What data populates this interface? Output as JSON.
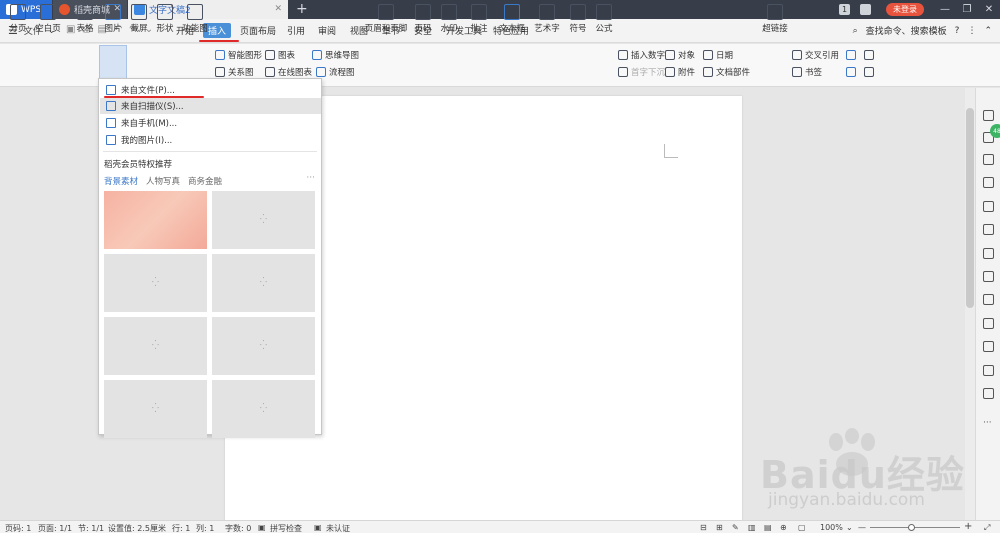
{
  "titlebar": {
    "tabs": [
      {
        "label": "WPS"
      },
      {
        "label": "稻壳商城"
      },
      {
        "label": "文字文稿2"
      }
    ],
    "badge": "1",
    "login_label": "未登录"
  },
  "menubar": {
    "file_label": "文件",
    "items": [
      "开始",
      "插入",
      "页面布局",
      "引用",
      "审阅",
      "视图",
      "章节",
      "安全",
      "开发工具",
      "特色应用"
    ],
    "active": "插入",
    "search_label": "查找命令、搜索模板"
  },
  "ribbon": {
    "big": [
      "分页",
      "空白页",
      "表格",
      "图片",
      "截屏",
      "形状",
      "功能图",
      "页眉和页脚",
      "页码",
      "水印",
      "批注",
      "文本框",
      "艺术字",
      "符号",
      "公式",
      "超链接"
    ],
    "small": {
      "smartart": "智能图形",
      "chart": "图表",
      "mindmap": "思维导图",
      "relation": "关系图",
      "online_chart": "在线图表",
      "flowchart": "流程图",
      "insert_number": "插入数字",
      "object": "对象",
      "date": "日期",
      "first_sink": "首字下沉",
      "attachment": "附件",
      "doc_parts": "文档部件",
      "crossref": "交叉引用",
      "bookmark": "书签"
    }
  },
  "dropdown": {
    "items": [
      "来自文件(P)...",
      "来自扫描仪(S)...",
      "来自手机(M)...",
      "我的图片(I)..."
    ],
    "section_title": "稻壳会员特权推荐",
    "tabs": [
      "背景素材",
      "人物写真",
      "商务金融"
    ],
    "more": "···"
  },
  "statusbar": {
    "page": "页码: 1",
    "pages": "页面: 1/1",
    "section": "节: 1/1",
    "setting": "设置值: 2.5厘米",
    "row": "行: 1",
    "col": "列: 1",
    "words": "字数: 0",
    "spell": "拼写检查",
    "auth": "未认证",
    "zoom": "100%"
  },
  "watermark": {
    "text": "Baidu经验",
    "sub": "jingyan.baidu.com"
  }
}
